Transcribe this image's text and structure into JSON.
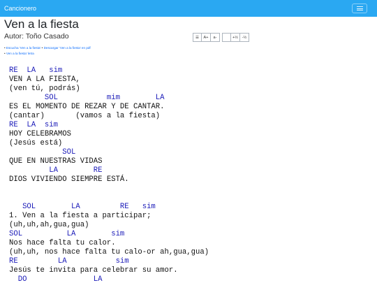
{
  "navbar": {
    "brand": "Cancionero",
    "menu_icon": "hamburger-icon"
  },
  "song": {
    "title": "Ven a la fiesta",
    "author": "Autor: Toño Casado",
    "links": {
      "listen": "Escucha 'Ven a la fiesta'",
      "separator": " • ",
      "download": "Descargar 'Ven a la fiesta' en pdf",
      "lyrics": "Ven a la fiesta' letra"
    },
    "toolbar": {
      "list": "☰",
      "font_up": "A+",
      "font_down": "a-",
      "blank": "",
      "transpose_up": "+½",
      "transpose_down": "-½"
    },
    "lines": [
      {
        "type": "chord",
        "text": "RE  LA   sim"
      },
      {
        "type": "lyric",
        "text": "VEN A LA FIESTA,"
      },
      {
        "type": "lyric",
        "text": "(ven tú, podrás)"
      },
      {
        "type": "chord",
        "text": "        SOL           mim        LA"
      },
      {
        "type": "lyric",
        "text": "ES EL MOMENTO DE REZAR Y DE CANTAR."
      },
      {
        "type": "lyric",
        "text": "(cantar)       (vamos a la fiesta)"
      },
      {
        "type": "chord",
        "text": "RE  LA  sim"
      },
      {
        "type": "lyric",
        "text": "HOY CELEBRAMOS"
      },
      {
        "type": "lyric",
        "text": "(Jesús está)"
      },
      {
        "type": "chord",
        "text": "            SOL"
      },
      {
        "type": "lyric",
        "text": "QUE EN NUESTRAS VIDAS"
      },
      {
        "type": "chord",
        "text": "         LA        RE"
      },
      {
        "type": "lyric",
        "text": "DIOS VIVIENDO SIEMPRE ESTÁ."
      },
      {
        "type": "blank",
        "text": ""
      },
      {
        "type": "blank",
        "text": ""
      },
      {
        "type": "chord",
        "text": "   SOL        LA         RE   sim"
      },
      {
        "type": "lyric",
        "text": "1. Ven a la fiesta a participar;"
      },
      {
        "type": "lyric",
        "text": "(uh,uh,ah,gua,gua)"
      },
      {
        "type": "chord",
        "text": "SOL          LA        sim"
      },
      {
        "type": "lyric",
        "text": "Nos hace falta tu calor."
      },
      {
        "type": "lyric",
        "text": "(uh,uh, nos hace falta tu calo-or ah,gua,gua)"
      },
      {
        "type": "chord",
        "text": "RE         LA           sim"
      },
      {
        "type": "lyric",
        "text": "Jesús te invita para celebrar su amor."
      },
      {
        "type": "chord",
        "text": "  DO               LA"
      }
    ]
  }
}
